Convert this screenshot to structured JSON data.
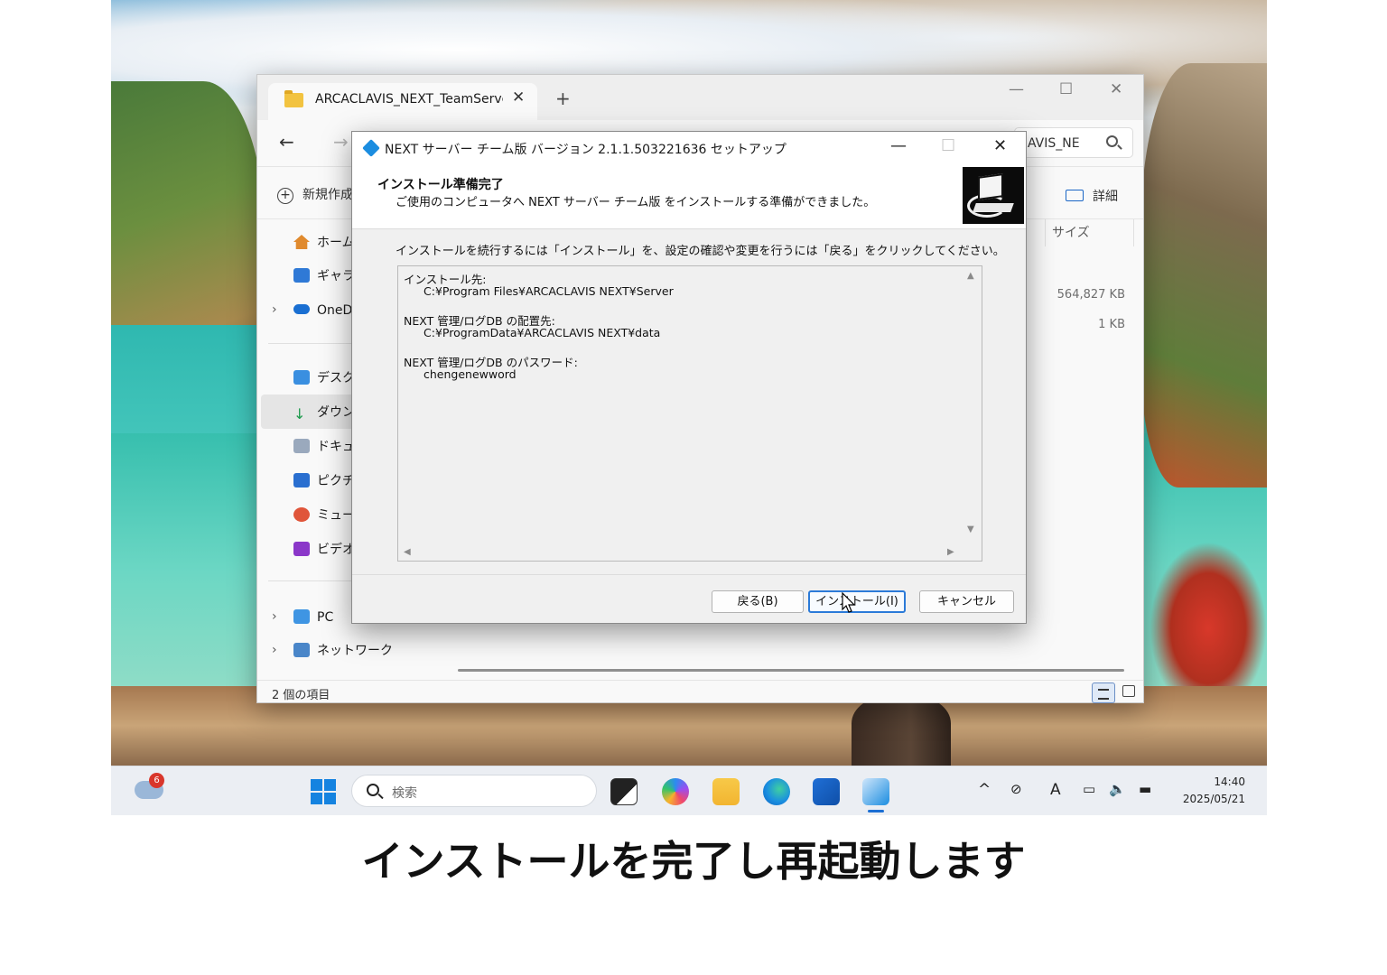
{
  "explorer": {
    "tab_title": "ARCACLAVIS_NEXT_TeamServer",
    "tab_close": "✕",
    "new_tab": "+",
    "minimize": "—",
    "maximize": "☐",
    "close": "✕",
    "back": "←",
    "forward": "→",
    "search_text": "AVIS_NE",
    "new_button": "新規作成",
    "details_button": "詳細",
    "sidebar": {
      "home": "ホーム",
      "gallery": "ギャラ",
      "onedrive": "OneD",
      "desktop": "デスク",
      "downloads": "ダウン",
      "documents": "ドキュ",
      "pictures": "ピクチ",
      "music": "ミュージ",
      "videos": "ビデオ",
      "pc": "PC",
      "network": "ネットワーク"
    },
    "column_size": "サイズ",
    "sizes": [
      "564,827 KB",
      "1 KB"
    ],
    "status": "2 個の項目"
  },
  "dialog": {
    "title": "NEXT サーバー チーム版 バージョン 2.1.1.503221636 セットアップ",
    "minimize": "—",
    "maximize": "☐",
    "close": "✕",
    "heading": "インストール準備完了",
    "subheading": "ご使用のコンピュータへ NEXT サーバー チーム版 をインストールする準備ができました。",
    "instruction": "インストールを続行するには「インストール」を、設定の確認や変更を行うには「戻る」をクリックしてください。",
    "memo": {
      "dest_label": "インストール先:",
      "dest_value": "C:¥Program Files¥ARCACLAVIS NEXT¥Server",
      "db_label": "NEXT 管理/ログDB の配置先:",
      "db_value": "C:¥ProgramData¥ARCACLAVIS NEXT¥data",
      "pw_label": "NEXT 管理/ログDB のパスワード:",
      "pw_value": "chengenewword"
    },
    "buttons": {
      "back": "戻る(B)",
      "install": "インストール(I)",
      "cancel": "キャンセル"
    }
  },
  "taskbar": {
    "weather_badge": "6",
    "search_placeholder": "検索",
    "tray": {
      "chevron": "^",
      "ime": "A"
    },
    "time": "14:40",
    "date": "2025/05/21"
  },
  "caption": "インストールを完了し再起動します",
  "colors": {
    "accent": "#1b6ed3",
    "dialog_bg": "#f0f0f0",
    "taskbar_bg": "#ebeef3"
  }
}
